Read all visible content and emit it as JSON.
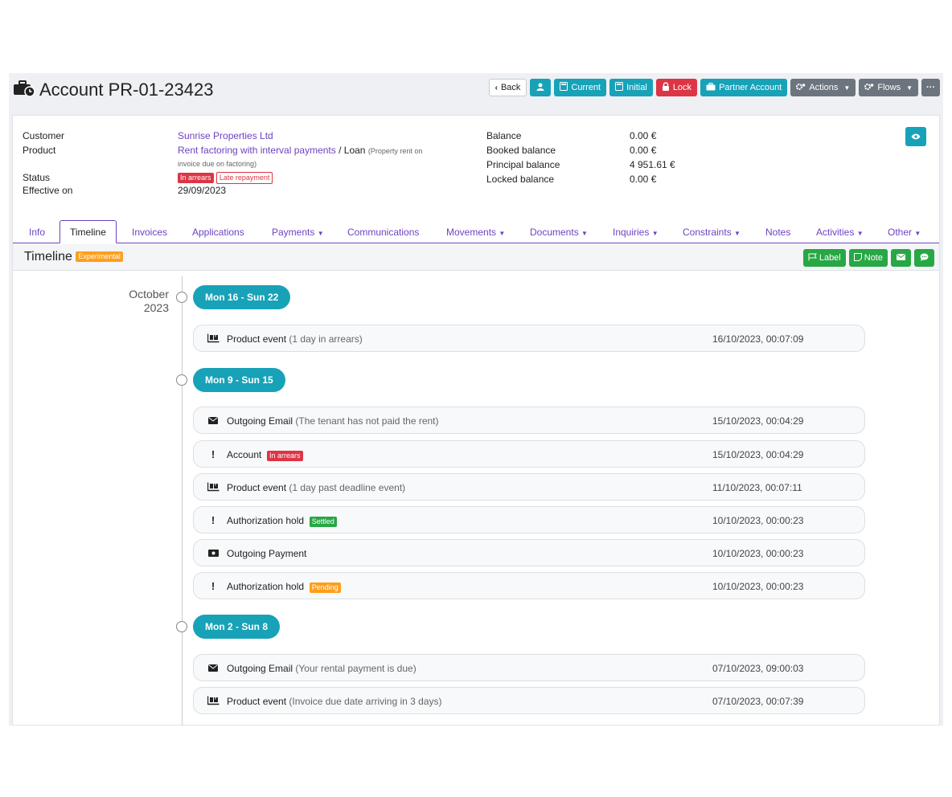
{
  "header": {
    "title": "Account PR-01-23423",
    "buttons": {
      "back": "Back",
      "current": "Current",
      "initial": "Initial",
      "lock": "Lock",
      "partner_account": "Partner Account",
      "actions": "Actions",
      "flows": "Flows",
      "more": "···"
    }
  },
  "account": {
    "customer_label": "Customer",
    "customer_value": "Sunrise Properties Ltd",
    "product_label": "Product",
    "product_value": "Rent factoring with interval payments",
    "product_sep": " / ",
    "product_type": "Loan",
    "product_note_1": "(Property rent on",
    "product_note_2": "invoice due on factoring)",
    "status_label": "Status",
    "status_badge_1": "In arrears",
    "status_badge_2": "Late repayment",
    "effective_label": "Effective on",
    "effective_value": "29/09/2023",
    "balance_label": "Balance",
    "balance_value": "0.00 €",
    "booked_label": "Booked balance",
    "booked_value": "0.00 €",
    "principal_label": "Principal balance",
    "principal_value": "4 951.61 €",
    "locked_label": "Locked balance",
    "locked_value": "0.00 €"
  },
  "tabs": [
    {
      "label": "Info"
    },
    {
      "label": "Timeline",
      "active": true
    },
    {
      "label": "Invoices"
    },
    {
      "label": "Applications"
    },
    {
      "label": "Payments"
    },
    {
      "label": "Communications"
    },
    {
      "label": "Movements"
    },
    {
      "label": "Documents"
    },
    {
      "label": "Inquiries"
    },
    {
      "label": "Constraints"
    },
    {
      "label": "Notes"
    },
    {
      "label": "Activities"
    },
    {
      "label": "Other"
    }
  ],
  "timeline": {
    "title": "Timeline",
    "badge": "Experimental",
    "buttons": {
      "label": "Label",
      "note": "Note"
    },
    "month_1": "October",
    "month_2": "2023",
    "weeks": [
      {
        "label": "Mon 16 - Sun 22",
        "events": [
          {
            "icon": "truck-icon",
            "title": "Product event",
            "sub": "(1 day in arrears)",
            "time": "16/10/2023, 00:07:09"
          }
        ]
      },
      {
        "label": "Mon 9 - Sun 15",
        "events": [
          {
            "icon": "envelope-icon",
            "title": "Outgoing Email",
            "sub": "(The tenant has not paid the rent)",
            "time": "15/10/2023, 00:04:29"
          },
          {
            "icon": "exclamation-icon",
            "title": "Account",
            "badge": "In arrears",
            "badge_color": "#dc3545",
            "time": "15/10/2023, 00:04:29"
          },
          {
            "icon": "truck-icon",
            "title": "Product event",
            "sub": "(1 day past deadline event)",
            "time": "11/10/2023, 00:07:11"
          },
          {
            "icon": "exclamation-icon",
            "title": "Authorization hold",
            "badge": "Settled",
            "badge_color": "#28a745",
            "time": "10/10/2023, 00:00:23"
          },
          {
            "icon": "money-icon",
            "title": "Outgoing Payment",
            "time": "10/10/2023, 00:00:23"
          },
          {
            "icon": "exclamation-icon",
            "title": "Authorization hold",
            "badge": "Pending",
            "badge_color": "#fd9f1d",
            "time": "10/10/2023, 00:00:23"
          }
        ]
      },
      {
        "label": "Mon 2 - Sun 8",
        "events": [
          {
            "icon": "envelope-icon",
            "title": "Outgoing Email",
            "sub": "(Your rental payment is due)",
            "time": "07/10/2023, 09:00:03"
          },
          {
            "icon": "truck-icon",
            "title": "Product event",
            "sub": "(Invoice due date arriving in 3 days)",
            "time": "07/10/2023, 00:07:39"
          }
        ]
      }
    ]
  }
}
